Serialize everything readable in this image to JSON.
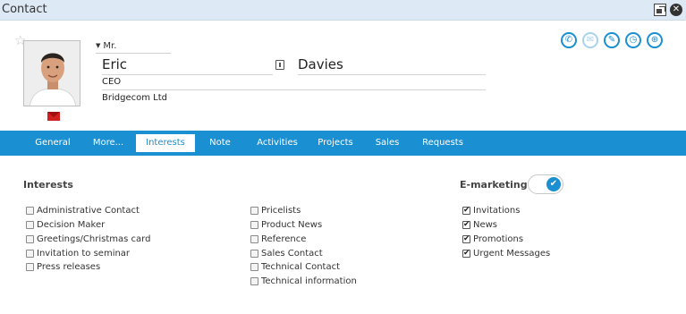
{
  "window": {
    "title": "Contact",
    "restore_icon": "restore-icon",
    "close_icon": "close-icon"
  },
  "contact": {
    "favorite_icon": "star-icon",
    "salutation": "Mr.",
    "first_name": "Eric",
    "last_name": "Davies",
    "job_title": "CEO",
    "company": "Bridgecom Ltd",
    "email_icon": "envelope-icon",
    "card_icon": "id-card-icon"
  },
  "actions": [
    {
      "icon": "phone-icon",
      "glyph": "✆"
    },
    {
      "icon": "email-icon",
      "glyph": "✉"
    },
    {
      "icon": "edit-icon",
      "glyph": "✎"
    },
    {
      "icon": "clock-icon",
      "glyph": "◷"
    },
    {
      "icon": "globe-icon",
      "glyph": "⊕"
    }
  ],
  "tabs": [
    {
      "label": "General",
      "active": false
    },
    {
      "label": "More...",
      "active": false
    },
    {
      "label": "Interests",
      "active": true
    },
    {
      "label": "Note",
      "active": false
    },
    {
      "label": "Activities",
      "active": false
    },
    {
      "label": "Projects",
      "active": false
    },
    {
      "label": "Sales",
      "active": false
    },
    {
      "label": "Requests",
      "active": false
    }
  ],
  "interests": {
    "heading": "Interests",
    "column1": [
      {
        "label": "Administrative Contact",
        "checked": false
      },
      {
        "label": "Decision Maker",
        "checked": false
      },
      {
        "label": "Greetings/Christmas card",
        "checked": false
      },
      {
        "label": "Invitation to seminar",
        "checked": false
      },
      {
        "label": "Press releases",
        "checked": false
      }
    ],
    "column2": [
      {
        "label": "Pricelists",
        "checked": false
      },
      {
        "label": "Product News",
        "checked": false
      },
      {
        "label": "Reference",
        "checked": false
      },
      {
        "label": "Sales Contact",
        "checked": false
      },
      {
        "label": "Technical Contact",
        "checked": false
      },
      {
        "label": "Technical information",
        "checked": false
      }
    ]
  },
  "emarketing": {
    "heading": "E-marketing",
    "enabled": true,
    "toggle_glyph": "✔",
    "items": [
      {
        "label": "Invitations",
        "checked": true
      },
      {
        "label": "News",
        "checked": true
      },
      {
        "label": "Promotions",
        "checked": true
      },
      {
        "label": "Urgent Messages",
        "checked": true
      }
    ]
  },
  "colors": {
    "accent": "#1a8fd1",
    "titlebar": "#dde9f5",
    "email_red": "#d02020"
  }
}
